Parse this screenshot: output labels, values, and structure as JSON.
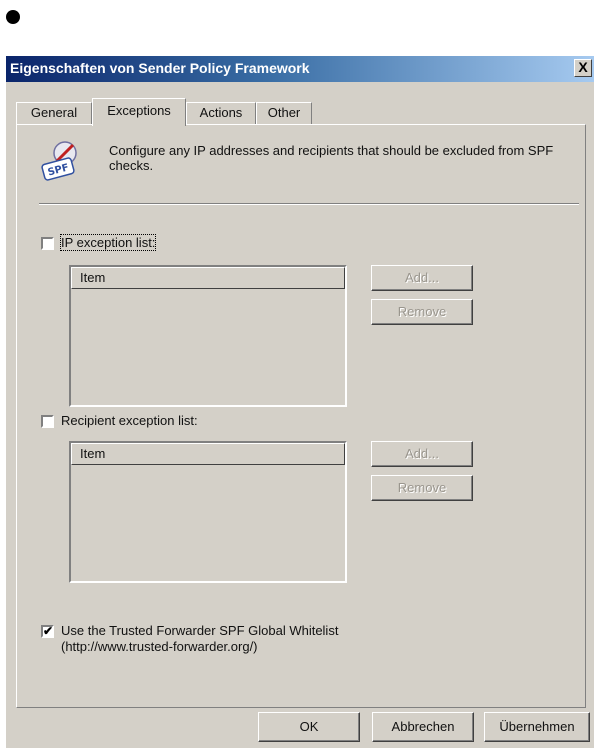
{
  "window": {
    "title": "Eigenschaften von Sender Policy Framework",
    "close_glyph": "X"
  },
  "tabs": [
    {
      "label": "General",
      "active": false
    },
    {
      "label": "Exceptions",
      "active": true
    },
    {
      "label": "Actions",
      "active": false
    },
    {
      "label": "Other",
      "active": false
    }
  ],
  "description": "Configure any IP addresses and recipients that should be excluded from SPF checks.",
  "icon": {
    "name": "spf-icon",
    "text": "SPF"
  },
  "ip_exceptions": {
    "checkbox_label": "IP exception list:",
    "checked": false,
    "column_header": "Item",
    "add_label": "Add...",
    "remove_label": "Remove"
  },
  "recipient_exceptions": {
    "checkbox_label": "Recipient exception list:",
    "checked": false,
    "column_header": "Item",
    "add_label": "Add...",
    "remove_label": "Remove"
  },
  "trusted_forwarder": {
    "label_line1": "Use the Trusted Forwarder SPF Global Whitelist",
    "label_line2": "(http://www.trusted-forwarder.org/)",
    "checked": true,
    "check_glyph": "✔"
  },
  "footer": {
    "ok_label": "OK",
    "cancel_label": "Abbrechen",
    "apply_label": "Übernehmen"
  }
}
